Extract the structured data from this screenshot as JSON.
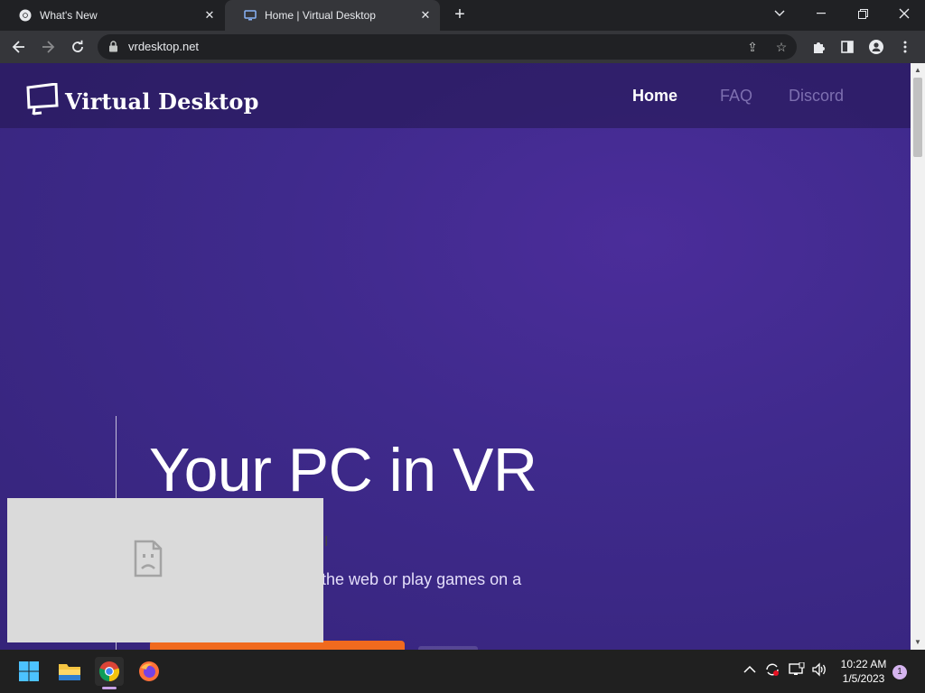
{
  "browser": {
    "tabs": [
      {
        "title": "What's New",
        "icon": "chrome-icon",
        "active": false
      },
      {
        "title": "Home | Virtual Desktop",
        "icon": "monitor-icon",
        "active": true
      }
    ],
    "new_tab_label": "+",
    "url": "vrdesktop.net"
  },
  "site": {
    "brand": "Virtual Desktop",
    "nav": [
      {
        "label": "Home",
        "active": true
      },
      {
        "label": "FAQ",
        "active": false
      },
      {
        "label": "Discord",
        "active": false
      }
    ],
    "hero_title": "Your PC in VR",
    "hero_subtitle_visible": "the web or play games on a"
  },
  "taskbar": {
    "apps": [
      "windows-start-icon",
      "file-explorer-icon",
      "chrome-icon",
      "firefox-icon"
    ],
    "time": "10:22 AM",
    "date": "1/5/2023",
    "notification_count": "1"
  },
  "colors": {
    "page_bg": "#3f2a8c",
    "cta": "#f06a1e",
    "chrome_dark": "#202124",
    "chrome_toolbar": "#35363a"
  }
}
